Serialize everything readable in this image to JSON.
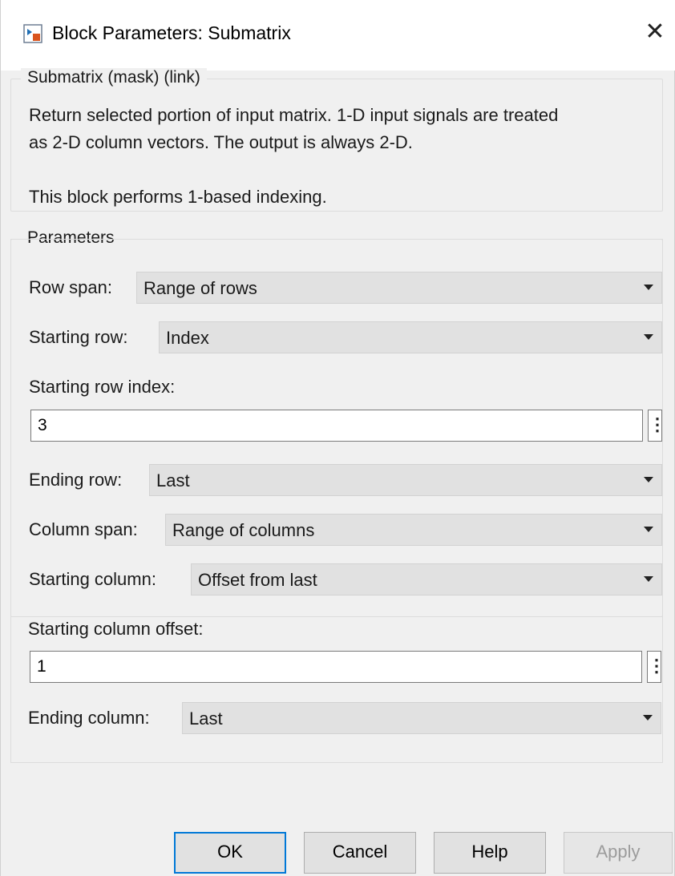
{
  "window": {
    "title": "Block Parameters: Submatrix",
    "app_icon": "simulink-block-icon",
    "close_label": "✕"
  },
  "description": {
    "legend": "Submatrix (mask) (link)",
    "line1": "Return selected portion of input matrix.  1-D input signals are treated",
    "line2": "as 2-D column vectors.  The output is always 2-D.",
    "line3": "This block performs 1-based indexing."
  },
  "parameters": {
    "legend": "Parameters",
    "row_span": {
      "label": "Row span:",
      "value": "Range of rows"
    },
    "starting_row": {
      "label": "Starting row:",
      "value": "Index"
    },
    "starting_row_index": {
      "label": "Starting row index:",
      "value": "3"
    },
    "ending_row": {
      "label": "Ending row:",
      "value": "Last"
    },
    "column_span": {
      "label": "Column span:",
      "value": "Range of columns"
    },
    "starting_column": {
      "label": "Starting column:",
      "value": "Offset from last"
    },
    "starting_column_offset": {
      "label": "Starting column offset:",
      "value": "1"
    },
    "ending_column": {
      "label": "Ending column:",
      "value": "Last"
    },
    "more_label": "⋮"
  },
  "buttons": {
    "ok": "OK",
    "cancel": "Cancel",
    "help": "Help",
    "apply": "Apply"
  },
  "colors": {
    "accent": "#0078d7",
    "dialog_bg": "#f0f0f0",
    "dropdown_bg": "#e1e1e1"
  }
}
